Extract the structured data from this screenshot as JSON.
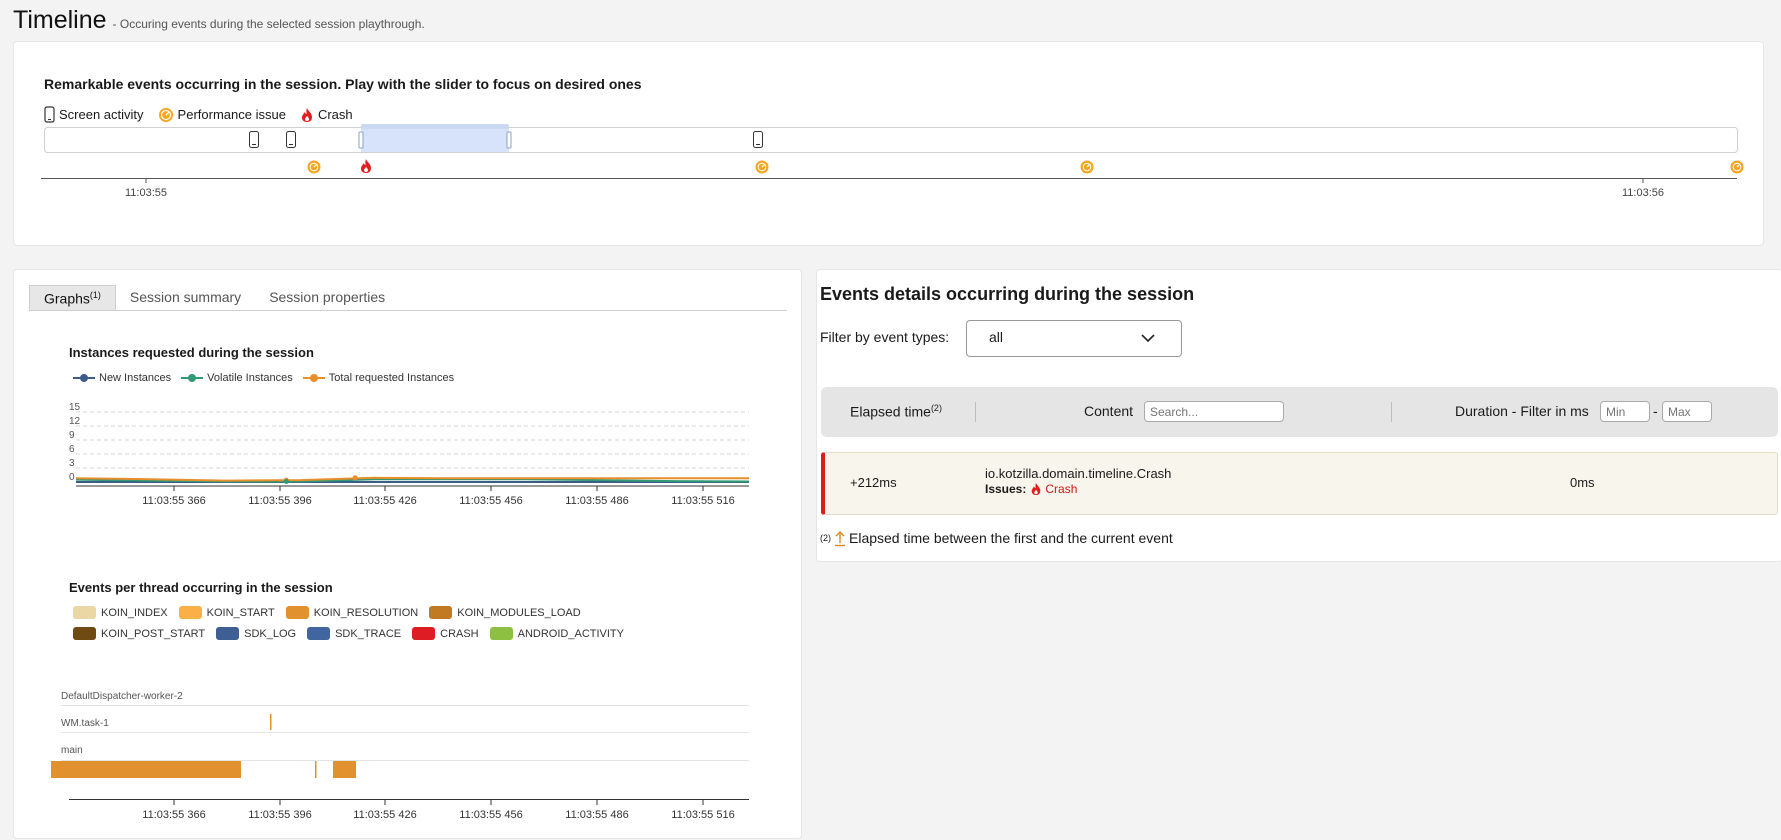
{
  "header": {
    "title": "Timeline",
    "subtitle": "- Occuring events during the selected session playthrough."
  },
  "timeline": {
    "heading": "Remarkable events occurring in the session. Play with the slider to focus on desired ones",
    "legend": {
      "screen": "Screen activity",
      "performance": "Performance issue",
      "crash": "Crash"
    },
    "axis_labels": [
      "11:03:55",
      "11:03:56"
    ],
    "slider_handle": "..."
  },
  "tabs": {
    "graphs": "Graphs",
    "graphs_note": "(1)",
    "summary": "Session summary",
    "properties": "Session properties"
  },
  "instances_chart": {
    "title": "Instances requested during the session",
    "series": [
      {
        "name": "New Instances",
        "color": "#3c5b8a"
      },
      {
        "name": "Volatile Instances",
        "color": "#2f9a73"
      },
      {
        "name": "Total requested Instances",
        "color": "#e88f2c"
      }
    ],
    "y_ticks": [
      "15",
      "12",
      "9",
      "6",
      "3",
      "0"
    ],
    "x_ticks": [
      "11:03:55 366",
      "11:03:55 396",
      "11:03:55 426",
      "11:03:55 456",
      "11:03:55 486",
      "11:03:55 516"
    ]
  },
  "chart_data": {
    "type": "line",
    "title": "Instances requested during the session",
    "x": [
      "11:03:55 345",
      "11:03:55 366",
      "11:03:55 384",
      "11:03:55 396",
      "11:03:55 409",
      "11:03:55 426",
      "11:03:55 456",
      "11:03:55 486",
      "11:03:55 516",
      "11:03:55 522"
    ],
    "ylim": [
      0,
      15
    ],
    "series": [
      {
        "name": "New Instances",
        "values": [
          0,
          0,
          0,
          0,
          0,
          0,
          0,
          0,
          0,
          0
        ]
      },
      {
        "name": "Volatile Instances",
        "values": [
          0.5,
          0.3,
          0.1,
          0.1,
          0.6,
          0.6,
          0.6,
          0.4,
          0.2,
          0.1
        ]
      },
      {
        "name": "Total requested Instances",
        "values": [
          0.8,
          0.6,
          0.3,
          0.4,
          0.9,
          0.8,
          0.8,
          0.8,
          0.8,
          0.8
        ]
      }
    ]
  },
  "thread_chart": {
    "title": "Events per thread occurring in the session",
    "legend": [
      {
        "name": "KOIN_INDEX",
        "color": "#ebd7a4"
      },
      {
        "name": "KOIN_START",
        "color": "#fbb047"
      },
      {
        "name": "KOIN_RESOLUTION",
        "color": "#e1922f"
      },
      {
        "name": "KOIN_MODULES_LOAD",
        "color": "#c27a22"
      },
      {
        "name": "KOIN_POST_START",
        "color": "#6f4a12"
      },
      {
        "name": "SDK_LOG",
        "color": "#3d5f93"
      },
      {
        "name": "SDK_TRACE",
        "color": "#41659e"
      },
      {
        "name": "CRASH",
        "color": "#de1c24"
      },
      {
        "name": "ANDROID_ACTIVITY",
        "color": "#8dc041"
      }
    ],
    "threads": [
      "DefaultDispatcher-worker-2",
      "WM.task-1",
      "main"
    ],
    "x_ticks": [
      "11:03:55 366",
      "11:03:55 396",
      "11:03:55 426",
      "11:03:55 456",
      "11:03:55 486",
      "11:03:55 516"
    ]
  },
  "events": {
    "title": "Events details occurring during the session",
    "filter_label": "Filter by event types:",
    "filter_value": "all",
    "columns": {
      "elapsed": "Elapsed time",
      "elapsed_note": "(2)",
      "content": "Content",
      "search_placeholder": "Search...",
      "duration": "Duration - Filter in ms",
      "min_placeholder": "Min",
      "max_placeholder": "Max",
      "range_sep": "-"
    },
    "rows": [
      {
        "elapsed": "+212ms",
        "content": "io.kotzilla.domain.timeline.Crash",
        "issues_label": "Issues:",
        "issue": "Crash",
        "duration": "0ms"
      }
    ],
    "footnote_mark": "(2)",
    "footnote": "Elapsed time between the first and the current event"
  },
  "colors": {
    "accent_blue": "#d6e3fa",
    "crash_red": "#e02020",
    "perf_orange": "#f6a623"
  }
}
